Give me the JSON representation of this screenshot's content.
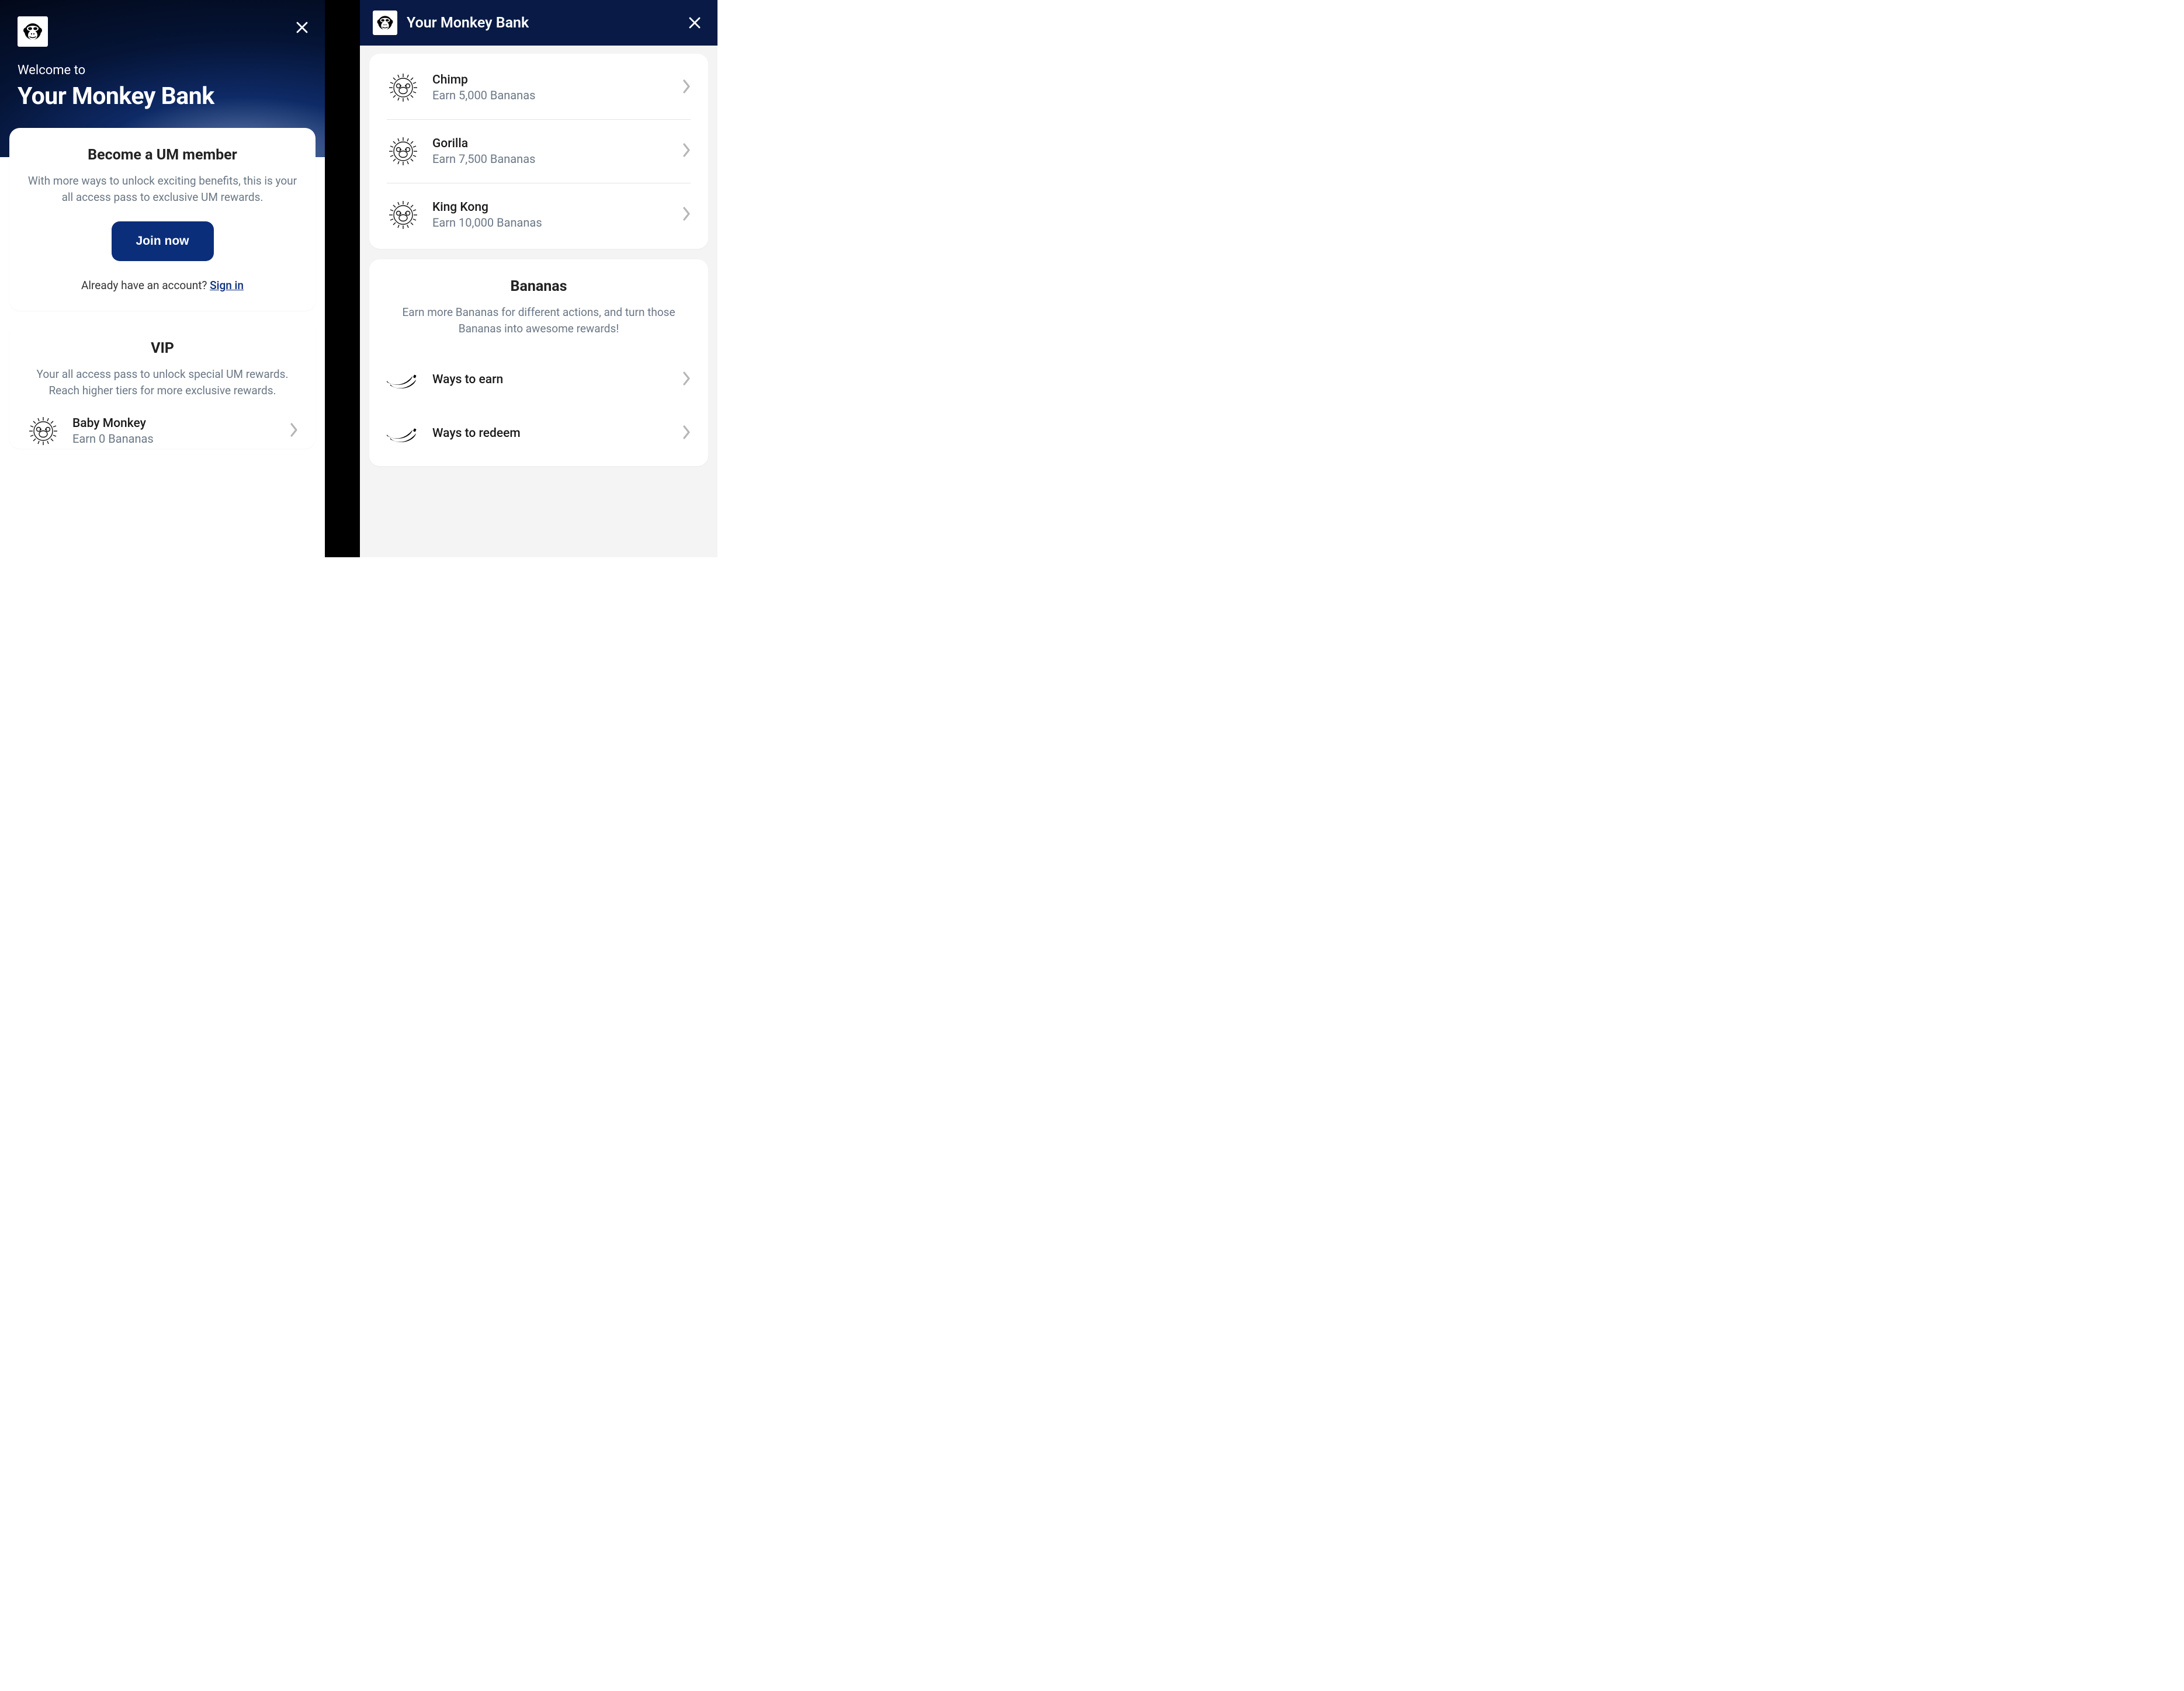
{
  "panelA": {
    "welcome": "Welcome to",
    "title": "Your Monkey Bank",
    "memberCard": {
      "title": "Become a UM member",
      "subtitle": "With more ways to unlock exciting benefits, this is your all access pass to exclusive UM rewards.",
      "joinLabel": "Join now",
      "accountPrompt": "Already have an account? ",
      "signInLabel": "Sign in"
    },
    "vipCard": {
      "title": "VIP",
      "subtitle": "Your all access pass to unlock special UM rewards. Reach higher tiers for more exclusive rewards.",
      "tier0": {
        "name": "Baby Monkey",
        "req": "Earn 0 Bananas"
      }
    }
  },
  "panelB": {
    "title": "Your Monkey Bank",
    "tiers": [
      {
        "name": "Chimp",
        "req": "Earn 5,000 Bananas"
      },
      {
        "name": "Gorilla",
        "req": "Earn 7,500 Bananas"
      },
      {
        "name": "King Kong",
        "req": "Earn 10,000 Bananas"
      }
    ],
    "bananasCard": {
      "title": "Bananas",
      "subtitle": "Earn more Bananas for different actions, and turn those Bananas into awesome rewards!",
      "earnLabel": "Ways to earn",
      "redeemLabel": "Ways to redeem"
    }
  }
}
